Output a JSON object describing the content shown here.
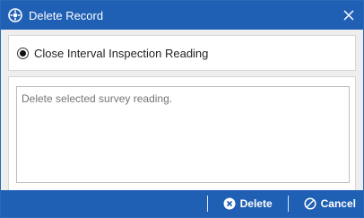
{
  "dialog": {
    "title": "Delete Record",
    "title_icon": "app-logo-icon",
    "close_icon": "close-icon"
  },
  "options": {
    "selected_label": "Close Interval Inspection Reading"
  },
  "description": {
    "placeholder": "Delete selected survey reading."
  },
  "footer": {
    "delete_label": "Delete",
    "delete_icon": "x-circle-icon",
    "cancel_label": "Cancel",
    "cancel_icon": "cancel-circle-icon"
  },
  "colors": {
    "accent": "#1f5fb4",
    "panel_background": "#eeeeee"
  }
}
